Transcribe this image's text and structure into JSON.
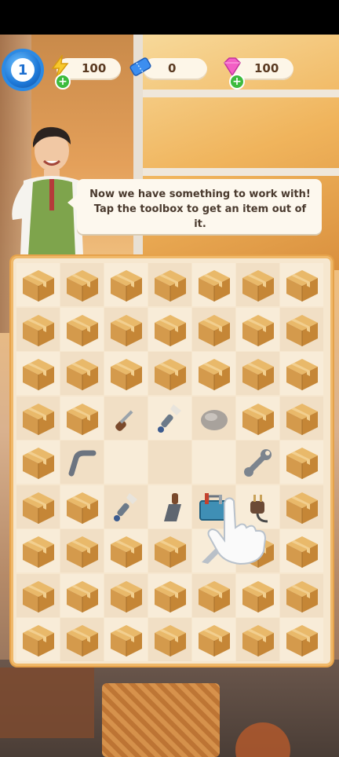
{
  "hud": {
    "level": "1",
    "energy": "100",
    "tickets": "0",
    "gems": "100"
  },
  "dialog": {
    "line1": "Now we have something to work with!",
    "line2": "Tap the toolbox to get an item out of it."
  },
  "colors": {
    "accent_blue": "#1d78d8",
    "bubble_bg": "#fdf8ee",
    "board_border": "#f0b96a",
    "plus_green": "#3dbb3d"
  },
  "board": {
    "cols": 7,
    "rows": 9,
    "grid": [
      [
        "box",
        "box",
        "box",
        "box",
        "box",
        "box",
        "box"
      ],
      [
        "box",
        "box",
        "box",
        "box",
        "box",
        "box",
        "box"
      ],
      [
        "box",
        "box",
        "box",
        "box",
        "box",
        "box",
        "box"
      ],
      [
        "box",
        "box",
        "screwdriver",
        "brush",
        "stone",
        "box",
        "box"
      ],
      [
        "box",
        "pipe",
        "empty",
        "empty",
        "empty",
        "wrench",
        "box"
      ],
      [
        "box",
        "box",
        "brush",
        "chisel",
        "toolbox",
        "plug",
        "box"
      ],
      [
        "box",
        "box",
        "box",
        "box",
        "knife",
        "box",
        "box"
      ],
      [
        "box",
        "box",
        "box",
        "box",
        "box",
        "box",
        "box"
      ],
      [
        "box",
        "box",
        "box",
        "box",
        "box",
        "box",
        "box"
      ]
    ]
  }
}
